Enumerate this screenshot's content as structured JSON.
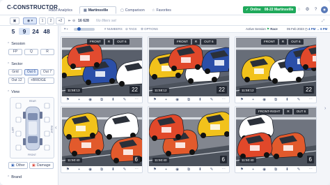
{
  "app": {
    "logo": "C-CONSTRUCTOR"
  },
  "tabs": [
    {
      "label": "Race Analytics",
      "active": false
    },
    {
      "label": "Martinsville",
      "active": true
    },
    {
      "label": "Comparison",
      "active": false
    },
    {
      "label": "Favorites",
      "active": false
    }
  ],
  "status": {
    "online_label": "Online",
    "session": "08-22 Martinsville"
  },
  "toolbar": {
    "pages": [
      "1",
      "2",
      "+2"
    ],
    "count": "16 628",
    "filter_placeholder": "No filters set",
    "filters": [
      "NUMBERS",
      "TAGS",
      "OPTIONS"
    ],
    "active_session_label": "Active Session",
    "active_session_value": "Race",
    "date": "05 Feb 2023",
    "time_from": "4 PM",
    "time_to": "6 PM"
  },
  "sidebar": {
    "grid_sizes": [
      "5",
      "9",
      "24",
      "48"
    ],
    "selected_grid": "9",
    "session": {
      "title": "Session",
      "chips": [
        "FP",
        "Q",
        "R"
      ],
      "selected": "R"
    },
    "sector": {
      "title": "Sector",
      "chips": [
        "Grid",
        "Out 6",
        "Out 7",
        "Out 12",
        "BRIDGE"
      ],
      "selected": "Out 6"
    },
    "view": {
      "title": "View",
      "labels": [
        "REAR",
        "FRONT",
        "LEFT",
        "RIGHT"
      ]
    },
    "buttons": [
      {
        "label": "Other"
      },
      {
        "label": "Damage"
      }
    ],
    "brand": {
      "title": "Brand"
    }
  },
  "tiles": [
    {
      "tags": [
        "FRONT",
        "R",
        "OUT 6"
      ],
      "time": "11:58:13",
      "count": "22",
      "scene": "a"
    },
    {
      "tags": [
        "FRONT",
        "R",
        "OUT 6"
      ],
      "time": "11:58:12",
      "count": "22",
      "scene": "b"
    },
    {
      "tags": [
        "FRONT",
        "R",
        "OUT 6"
      ],
      "time": "11:58:12",
      "count": "22",
      "scene": "c"
    },
    {
      "tags": [],
      "time": "11:50:40",
      "count": "6",
      "scene": "d"
    },
    {
      "tags": [],
      "time": "11:50:40",
      "count": "6",
      "scene": "e"
    },
    {
      "tags": [
        "FRONT-RIGHT",
        "R",
        "OUT 6"
      ],
      "time": "11:50:40",
      "count": "6",
      "scene": "f"
    }
  ],
  "tile_actions": [
    "flag-icon",
    "plus-icon",
    "eye-icon",
    "copy-icon",
    "download-icon",
    "edit-icon",
    "more-icon"
  ],
  "colors": {
    "accent": "#2f5fb3",
    "online": "#1fa95b",
    "tile_badge": "#1e222c"
  }
}
